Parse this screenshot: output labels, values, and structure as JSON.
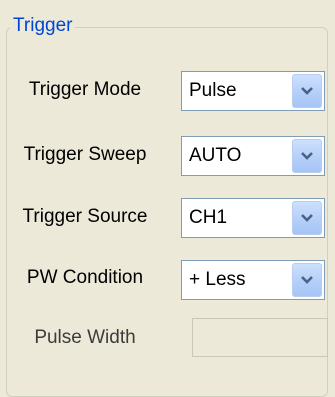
{
  "group": {
    "title": "Trigger"
  },
  "rows": [
    {
      "label": "Trigger Mode",
      "value": "Pulse",
      "icon": "chevron-down-icon"
    },
    {
      "label": "Trigger Sweep",
      "value": "AUTO",
      "icon": "chevron-down-icon"
    },
    {
      "label": "Trigger Source",
      "value": "CH1",
      "icon": "chevron-down-icon"
    },
    {
      "label": "PW Condition",
      "value": "+ Less",
      "icon": "chevron-down-icon"
    }
  ],
  "pulse_width": {
    "label": "Pulse Width",
    "value": ""
  },
  "colors": {
    "background": "#ece9d8",
    "title": "#0046d5",
    "combo_border": "#7f9db9",
    "arrow": "#4d6185"
  }
}
